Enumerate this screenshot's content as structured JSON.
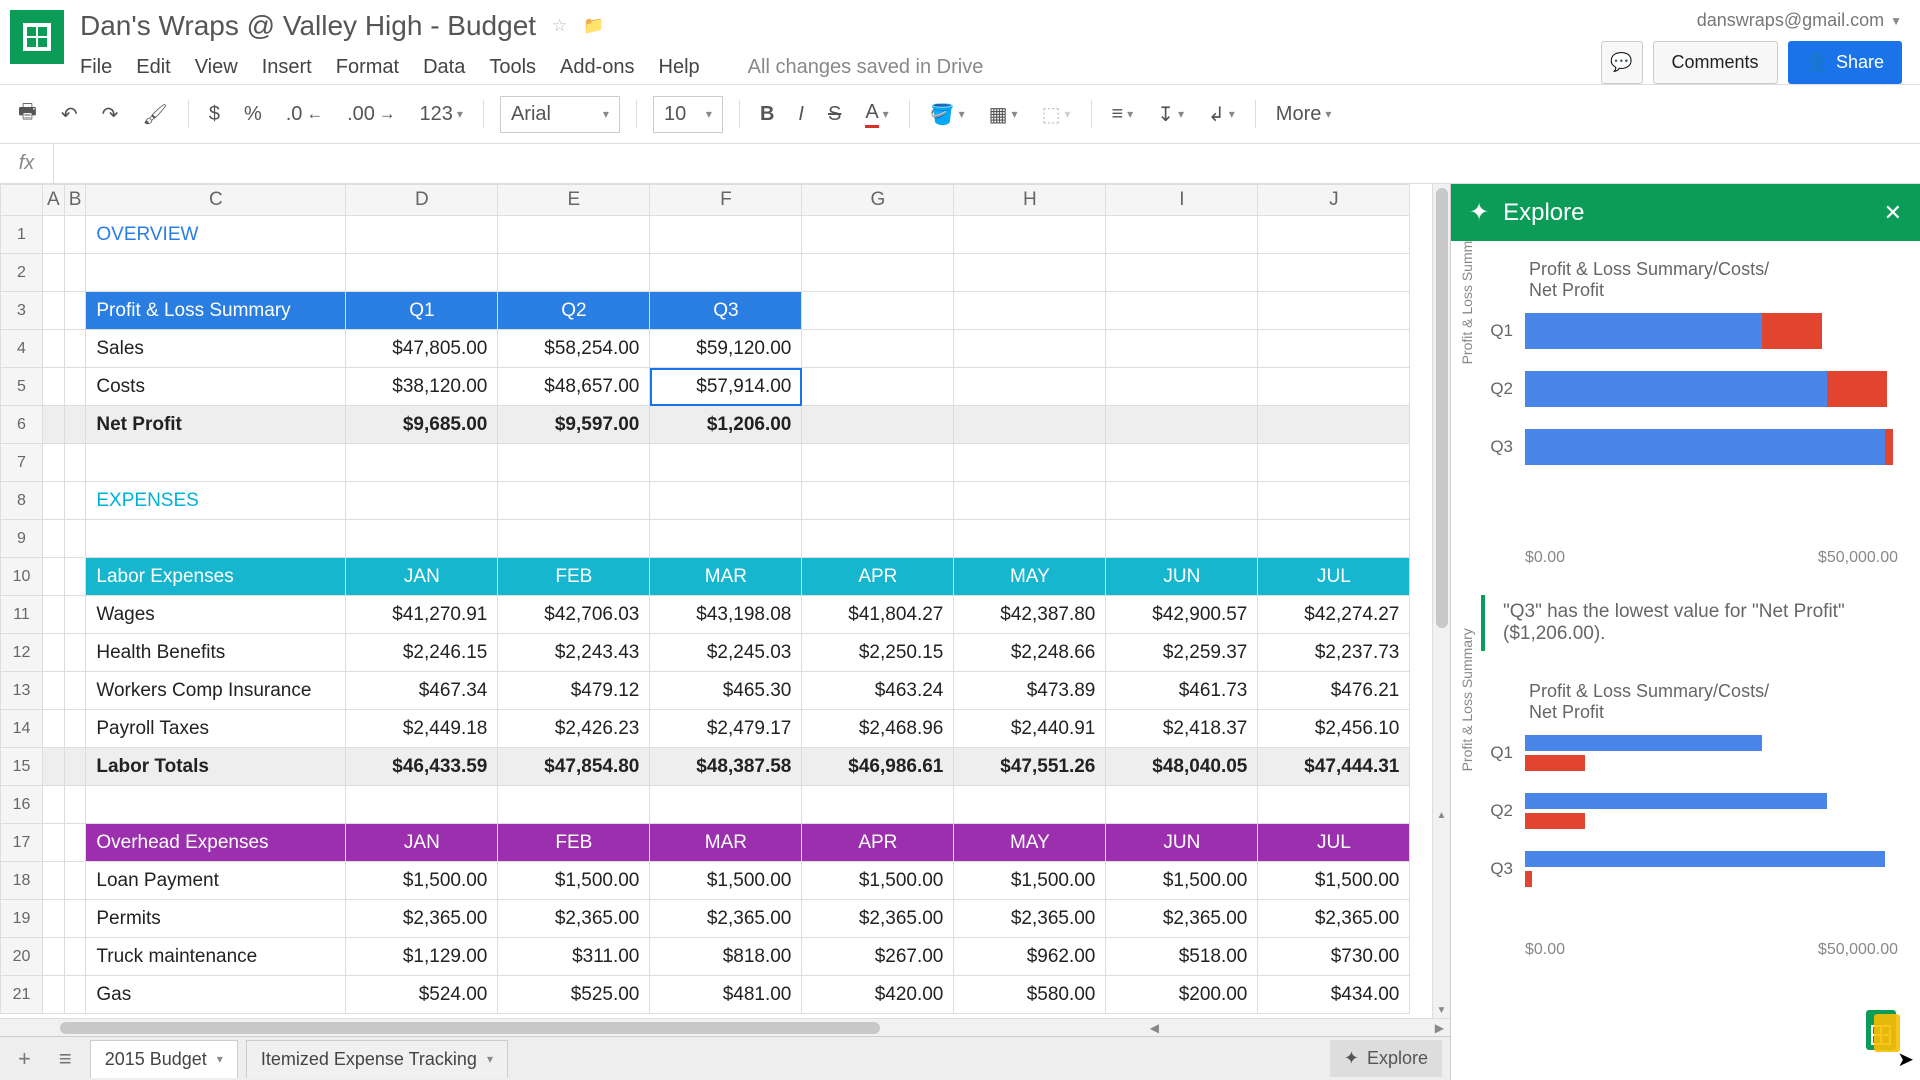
{
  "header": {
    "title": "Dan's Wraps @ Valley High - Budget",
    "user_email": "danswraps@gmail.com",
    "comments_label": "Comments",
    "share_label": "Share",
    "menu": [
      "File",
      "Edit",
      "View",
      "Insert",
      "Format",
      "Data",
      "Tools",
      "Add-ons",
      "Help"
    ],
    "status": "All changes saved in Drive"
  },
  "toolbar": {
    "font": "Arial",
    "size": "10",
    "more": "More"
  },
  "columns": [
    "A",
    "B",
    "C",
    "D",
    "E",
    "F",
    "G",
    "H",
    "I",
    "J"
  ],
  "sheet": {
    "overview": "OVERVIEW",
    "expenses_title": "EXPENSES",
    "pl": {
      "header": "Profit & Loss Summary",
      "quarters": [
        "Q1",
        "Q2",
        "Q3"
      ],
      "rows": [
        {
          "label": "Sales",
          "values": [
            "$47,805.00",
            "$58,254.00",
            "$59,120.00"
          ]
        },
        {
          "label": "Costs",
          "values": [
            "$38,120.00",
            "$48,657.00",
            "$57,914.00"
          ]
        },
        {
          "label": "Net Profit",
          "values": [
            "$9,685.00",
            "$9,597.00",
            "$1,206.00"
          ]
        }
      ]
    },
    "labor": {
      "header": "Labor Expenses",
      "months": [
        "JAN",
        "FEB",
        "MAR",
        "APR",
        "MAY",
        "JUN",
        "JUL"
      ],
      "rows": [
        {
          "label": "Wages",
          "values": [
            "$41,270.91",
            "$42,706.03",
            "$43,198.08",
            "$41,804.27",
            "$42,387.80",
            "$42,900.57",
            "$42,274.27"
          ]
        },
        {
          "label": "Health Benefits",
          "values": [
            "$2,246.15",
            "$2,243.43",
            "$2,245.03",
            "$2,250.15",
            "$2,248.66",
            "$2,259.37",
            "$2,237.73"
          ]
        },
        {
          "label": "Workers Comp Insurance",
          "values": [
            "$467.34",
            "$479.12",
            "$465.30",
            "$463.24",
            "$473.89",
            "$461.73",
            "$476.21"
          ]
        },
        {
          "label": "Payroll Taxes",
          "values": [
            "$2,449.18",
            "$2,426.23",
            "$2,479.17",
            "$2,468.96",
            "$2,440.91",
            "$2,418.37",
            "$2,456.10"
          ]
        },
        {
          "label": "Labor Totals",
          "values": [
            "$46,433.59",
            "$47,854.80",
            "$48,387.58",
            "$46,986.61",
            "$47,551.26",
            "$48,040.05",
            "$47,444.31"
          ]
        }
      ]
    },
    "overhead": {
      "header": "Overhead Expenses",
      "months": [
        "JAN",
        "FEB",
        "MAR",
        "APR",
        "MAY",
        "JUN",
        "JUL"
      ],
      "rows": [
        {
          "label": "Loan Payment",
          "values": [
            "$1,500.00",
            "$1,500.00",
            "$1,500.00",
            "$1,500.00",
            "$1,500.00",
            "$1,500.00",
            "$1,500.00"
          ]
        },
        {
          "label": "Permits",
          "values": [
            "$2,365.00",
            "$2,365.00",
            "$2,365.00",
            "$2,365.00",
            "$2,365.00",
            "$2,365.00",
            "$2,365.00"
          ]
        },
        {
          "label": "Truck maintenance",
          "values": [
            "$1,129.00",
            "$311.00",
            "$818.00",
            "$267.00",
            "$962.00",
            "$518.00",
            "$730.00"
          ]
        },
        {
          "label": "Gas",
          "values": [
            "$524.00",
            "$525.00",
            "$481.00",
            "$420.00",
            "$580.00",
            "$200.00",
            "$434.00"
          ]
        }
      ]
    }
  },
  "tabs": {
    "t1": "2015 Budget",
    "t2": "Itemized Expense Tracking"
  },
  "explore": {
    "title": "Explore",
    "chart_title": "Profit & Loss Summary/Costs/\nNet Profit",
    "ylabel": "Profit & Loss Summary",
    "axis": [
      "$0.00",
      "$50,000.00"
    ],
    "insight": "\"Q3\" has the lowest value for \"Net Profit\" ($1,206.00).",
    "button": "Explore"
  },
  "chart_data": [
    {
      "type": "bar",
      "title": "Profit & Loss Summary/Costs/Net Profit",
      "categories": [
        "Q1",
        "Q2",
        "Q3"
      ],
      "series": [
        {
          "name": "Costs",
          "values": [
            38120,
            48657,
            57914
          ]
        },
        {
          "name": "Net Profit",
          "values": [
            9685,
            9597,
            1206
          ]
        }
      ],
      "xlim": [
        0,
        60000
      ],
      "xlabel": "",
      "ylabel": "Profit & Loss Summary",
      "orientation": "horizontal",
      "stacked": true
    },
    {
      "type": "bar",
      "title": "Profit & Loss Summary/Costs/Net Profit",
      "categories": [
        "Q1",
        "Q2",
        "Q3"
      ],
      "series": [
        {
          "name": "Costs",
          "values": [
            38120,
            48657,
            57914
          ]
        },
        {
          "name": "Net Profit",
          "values": [
            9685,
            9597,
            1206
          ]
        }
      ],
      "xlim": [
        0,
        60000
      ],
      "xlabel": "",
      "ylabel": "Profit & Loss Summary",
      "orientation": "horizontal",
      "stacked": false
    }
  ]
}
